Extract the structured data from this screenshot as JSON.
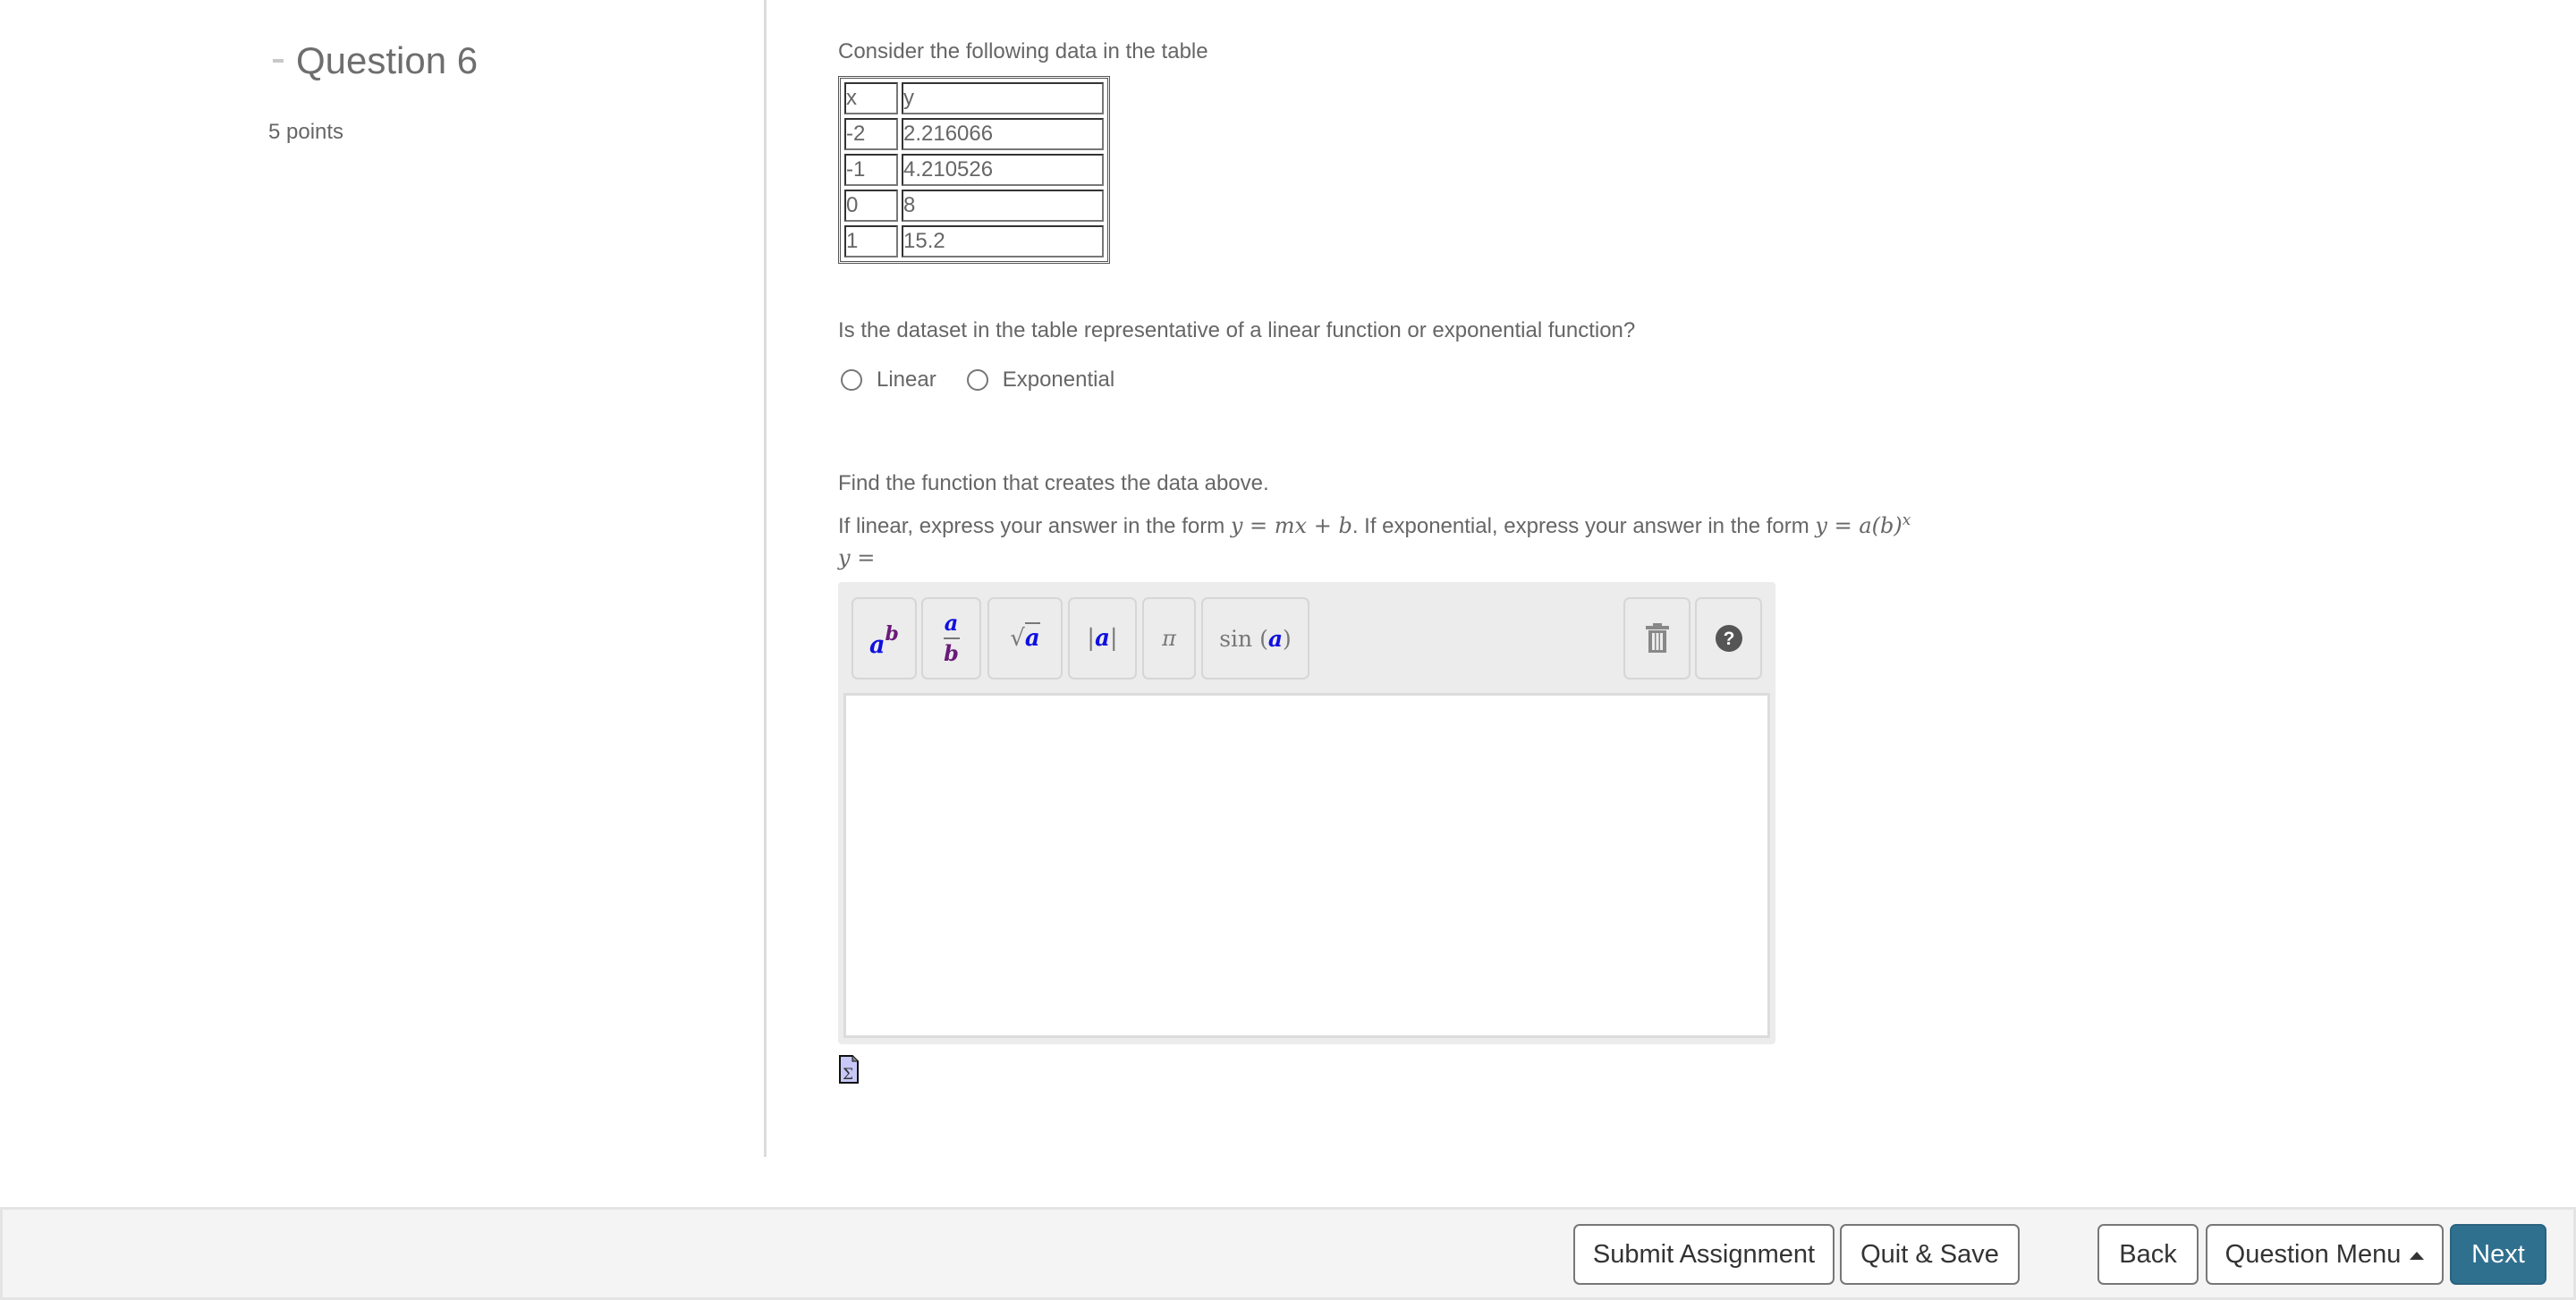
{
  "sidebar": {
    "question_title": "Question 6",
    "points": "5 points",
    "collapse_icon": "minus-icon"
  },
  "content": {
    "intro": "Consider the following data in the table",
    "table": {
      "headers": [
        "x",
        "y"
      ],
      "rows": [
        [
          "-2",
          "2.216066"
        ],
        [
          "-1",
          "4.210526"
        ],
        [
          "0",
          "8"
        ],
        [
          "1",
          "15.2"
        ]
      ]
    },
    "question1": "Is the dataset in the table representative of a linear function or exponential function?",
    "options": [
      {
        "label": "Linear",
        "selected": false
      },
      {
        "label": "Exponential",
        "selected": false
      }
    ],
    "find_text": "Find the function that creates the data above.",
    "form_text": {
      "part1": "If linear, express your answer in the form ",
      "linear_form": "y = mx + b",
      "part2": ". If exponential, express your answer in the form ",
      "exp_form": "y = a(b)",
      "exp_sup": "x"
    },
    "answer_prefix": "y =",
    "answer_value": ""
  },
  "editor": {
    "toolbar": [
      {
        "name": "exponent-button",
        "icon": "power-icon"
      },
      {
        "name": "fraction-button",
        "icon": "fraction-icon"
      },
      {
        "name": "sqrt-button",
        "icon": "sqrt-icon"
      },
      {
        "name": "abs-button",
        "icon": "absolute-value-icon"
      },
      {
        "name": "pi-button",
        "icon": "pi-icon",
        "label": "π"
      },
      {
        "name": "sin-button",
        "icon": "sin-icon",
        "label": "sin"
      }
    ],
    "trash_icon": "trash-icon",
    "help_icon": "help-icon",
    "sigma_icon": "sigma-file-icon"
  },
  "footer": {
    "submit_label": "Submit Assignment",
    "quit_label": "Quit & Save",
    "back_label": "Back",
    "menu_label": "Question Menu",
    "next_label": "Next",
    "accent_color": "#30708f"
  }
}
